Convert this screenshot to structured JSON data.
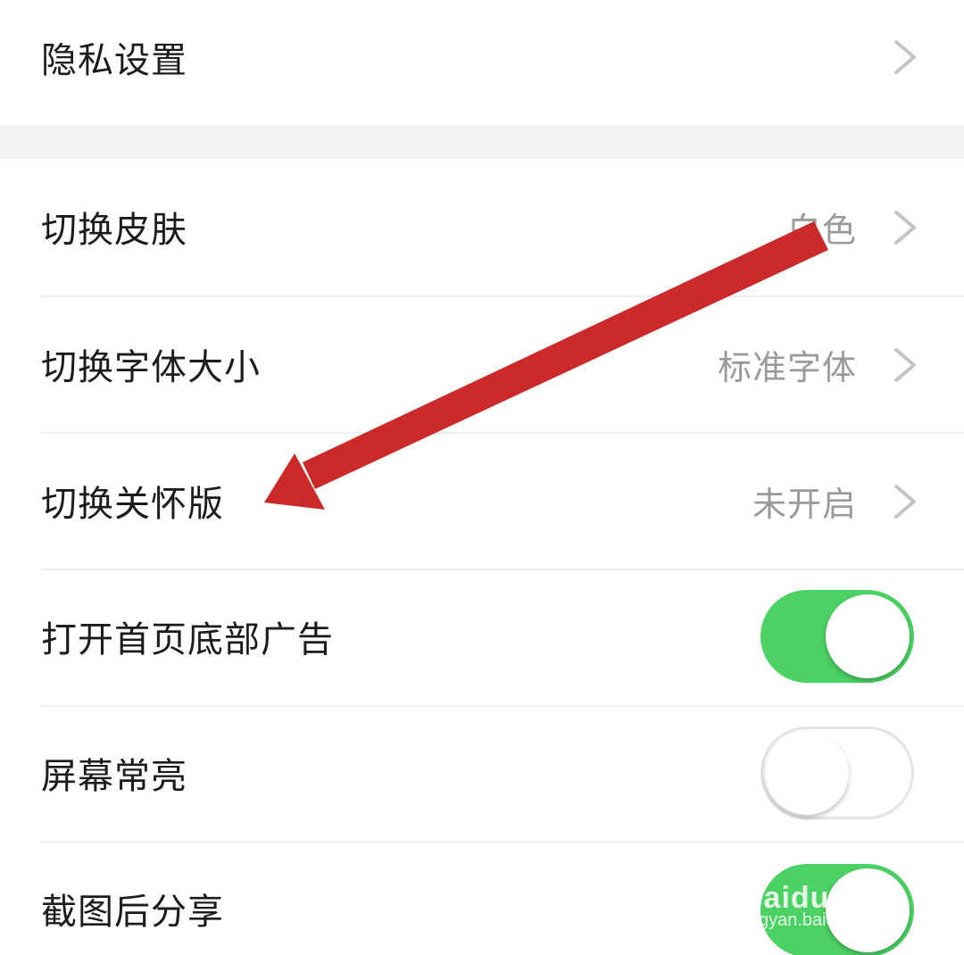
{
  "settings": {
    "privacy": {
      "label": "隐私设置"
    },
    "skin": {
      "label": "切换皮肤",
      "value": "白色"
    },
    "font_size": {
      "label": "切换字体大小",
      "value": "标准字体"
    },
    "care_mode": {
      "label": "切换关怀版",
      "value": "未开启"
    },
    "home_ad": {
      "label": "打开首页底部广告",
      "toggle": "on"
    },
    "screen_on": {
      "label": "屏幕常亮",
      "toggle": "off"
    },
    "share_screenshot": {
      "label": "截图后分享",
      "toggle": "on"
    }
  },
  "annotation": {
    "arrow_color": "#cc2a2a",
    "arrow_direction": "pointing-left-down-to-care-mode"
  },
  "watermark": {
    "brand": "Baidu 经验",
    "site": "jingyan.baidu.com"
  },
  "colors": {
    "toggle_on": "#4cd264",
    "label_text": "#1c1c1c",
    "value_text": "#9a9a9a",
    "section_gap": "#f3f4f6"
  }
}
